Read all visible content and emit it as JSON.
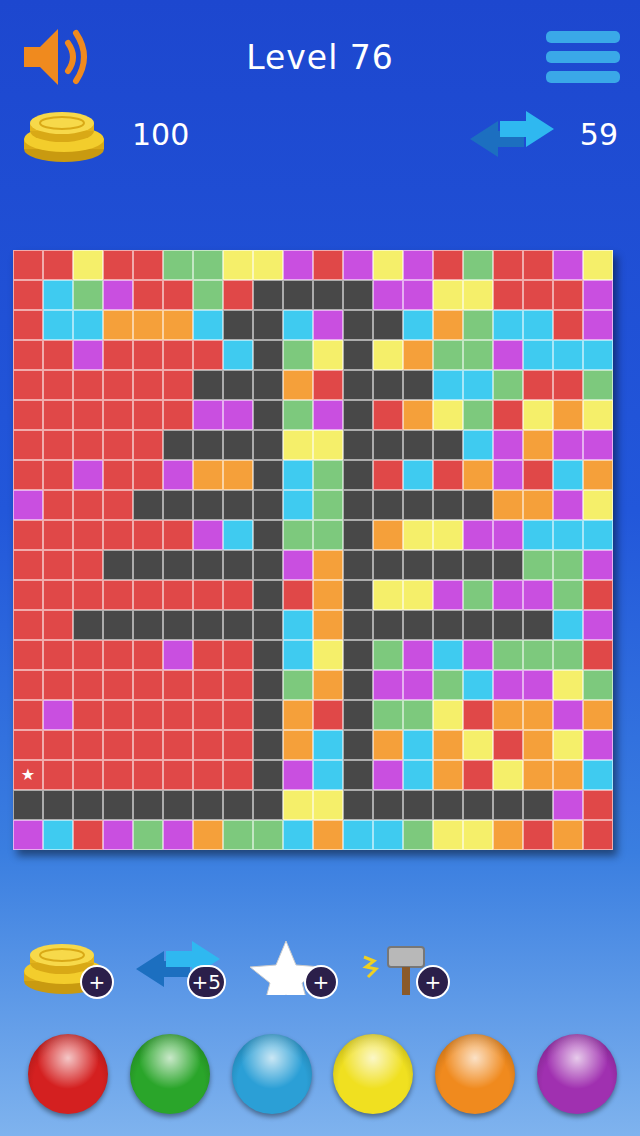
{
  "header": {
    "title": "Level 76"
  },
  "coins": {
    "count": "100"
  },
  "moves": {
    "count": "59"
  },
  "grid": {
    "palette": {
      "R": "#e04848",
      "G": "#7dc97d",
      "B": "#3fcbf0",
      "Y": "#f5ef6a",
      "O": "#f5a03a",
      "P": "#c94fe0",
      "K": "#484848"
    },
    "rows": [
      "RRYRRGGYYPRPYPRGRRPY",
      "RBGPRRGRKKKKPPYYRRRP",
      "RBBOOOBKKBPKKBOGBBRP",
      "RRPRRRRBKGYKYOGGPBBB",
      "RRRRRRKKKORKKKBBGRRG",
      "RRRRRRPPKGPKROYGRYOY",
      "RRRRRKKKKYYKKKKBPOPP",
      "RRPRRPOOKBGKRBROPRBO",
      "PRRRKKKKKBGKKKKKOOPY",
      "RRRRRRPBKGGKOYYPPBBB",
      "RRRKKKKKKPOKKKKKKGGP",
      "RRRRRRRRKROKYYPGPPGR",
      "RRKKKKKKKBOKKKKKKKBP",
      "RRRRRPRRKBYKGPBPGGGR",
      "RRRRRRRRKGOKPPGBPPYG",
      "RPRRRRRRKORKGGYROOPO",
      "RRRRRRRRKOBKOBOYROYP",
      "RRRRRRRRKPBKPBORYOOB",
      "KKKKKKKKKYYKKKKKKKPR",
      "PBRPGPOGGBOBBGYYOROR"
    ],
    "star": {
      "glyph": "★",
      "row": 17,
      "col": 0
    }
  },
  "boosters": [
    {
      "name": "coins",
      "badge": "+"
    },
    {
      "name": "moves",
      "badge": "+5"
    },
    {
      "name": "star",
      "badge": "+"
    },
    {
      "name": "hammer",
      "badge": "+"
    }
  ],
  "color_buttons": [
    {
      "color": "#d42020"
    },
    {
      "color": "#2aa52a"
    },
    {
      "color": "#2b9fd6"
    },
    {
      "color": "#f0e020"
    },
    {
      "color": "#f08a1e"
    },
    {
      "color": "#a030b0"
    }
  ]
}
